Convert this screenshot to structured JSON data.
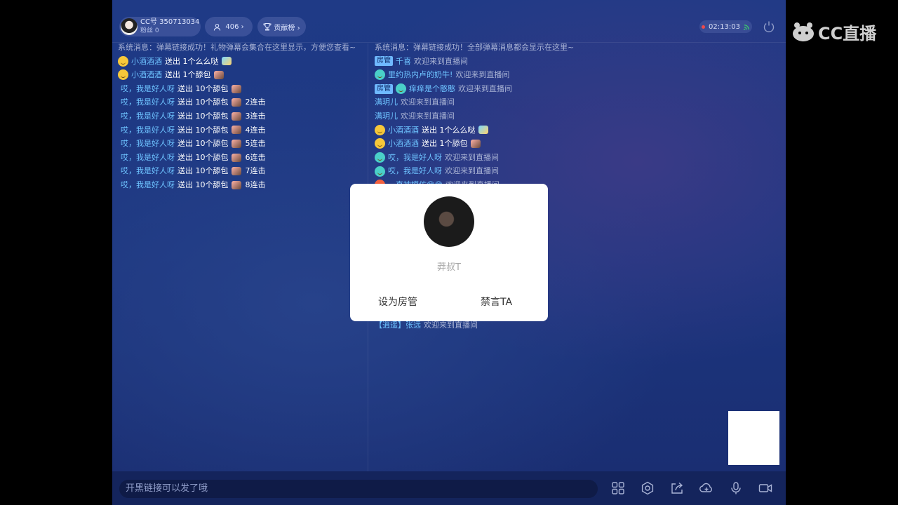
{
  "header": {
    "account": "CC号 350713034",
    "fans": "粉丝 0",
    "online_count": "406 ›",
    "rank_label": "贡献榜 ›",
    "timer": "02:13:03"
  },
  "left_chat": {
    "system_message": "系统消息：弹幕链接成功！礼物弹幕会集合在这里显示，方便您查看~",
    "messages": [
      {
        "user": "小酒酒酒",
        "action": "送出 1个么么哒",
        "combo": ""
      },
      {
        "user": "小酒酒酒",
        "action": "送出 1个舔包",
        "combo": ""
      },
      {
        "user": "哎，我是好人呀",
        "action": "送出 10个舔包",
        "combo": ""
      },
      {
        "user": "哎，我是好人呀",
        "action": "送出 10个舔包",
        "combo": "2连击"
      },
      {
        "user": "哎，我是好人呀",
        "action": "送出 10个舔包",
        "combo": "3连击"
      },
      {
        "user": "哎，我是好人呀",
        "action": "送出 10个舔包",
        "combo": "4连击"
      },
      {
        "user": "哎，我是好人呀",
        "action": "送出 10个舔包",
        "combo": "5连击"
      },
      {
        "user": "哎，我是好人呀",
        "action": "送出 10个舔包",
        "combo": "6连击"
      },
      {
        "user": "哎，我是好人呀",
        "action": "送出 10个舔包",
        "combo": "7连击"
      },
      {
        "user": "哎，我是好人呀",
        "action": "送出 10个舔包",
        "combo": "8连击"
      }
    ]
  },
  "right_chat": {
    "system_message": "系统消息：弹幕链接成功！全部弹幕消息都会显示在这里~",
    "messages": [
      {
        "tag": "房管",
        "user": "千喜",
        "text": "欢迎来到直播间"
      },
      {
        "tag": "",
        "user": "里约热内卢的奶牛!",
        "text": "欢迎来到直播间"
      },
      {
        "tag": "房管",
        "user": "痒痒是个憨憨",
        "text": "欢迎来到直播间"
      },
      {
        "tag": "",
        "user": "满玥儿",
        "text": "欢迎来到直播间"
      },
      {
        "tag": "",
        "user": "满玥儿",
        "text": "欢迎来到直播间"
      },
      {
        "tag": "",
        "user": "小酒酒酒",
        "text": "送出 1个么么哒"
      },
      {
        "tag": "",
        "user": "小酒酒酒",
        "text": "送出 1个舔包"
      },
      {
        "tag": "",
        "user": "哎，我是好人呀",
        "text": "欢迎来到直播间"
      },
      {
        "tag": "",
        "user": "哎，我是好人呀",
        "text": "欢迎来到直播间"
      },
      {
        "tag": "",
        "user": "一直被模仿😊😊",
        "text": "欢迎来到直播间"
      }
    ],
    "last_message": {
      "user": "【逍遥】张远",
      "text": "欢迎来到直播间"
    }
  },
  "modal": {
    "username": "莽叔T",
    "set_admin": "设为房管",
    "mute": "禁言TA"
  },
  "bottom": {
    "input_placeholder": "开黑链接可以发了哦"
  },
  "logo": {
    "text": "CC直播"
  },
  "colors": {
    "background": "#1c3680",
    "username": "#6ec3ff",
    "admin_tag": "#6fb9ff",
    "live_dot": "#f04a4a"
  }
}
